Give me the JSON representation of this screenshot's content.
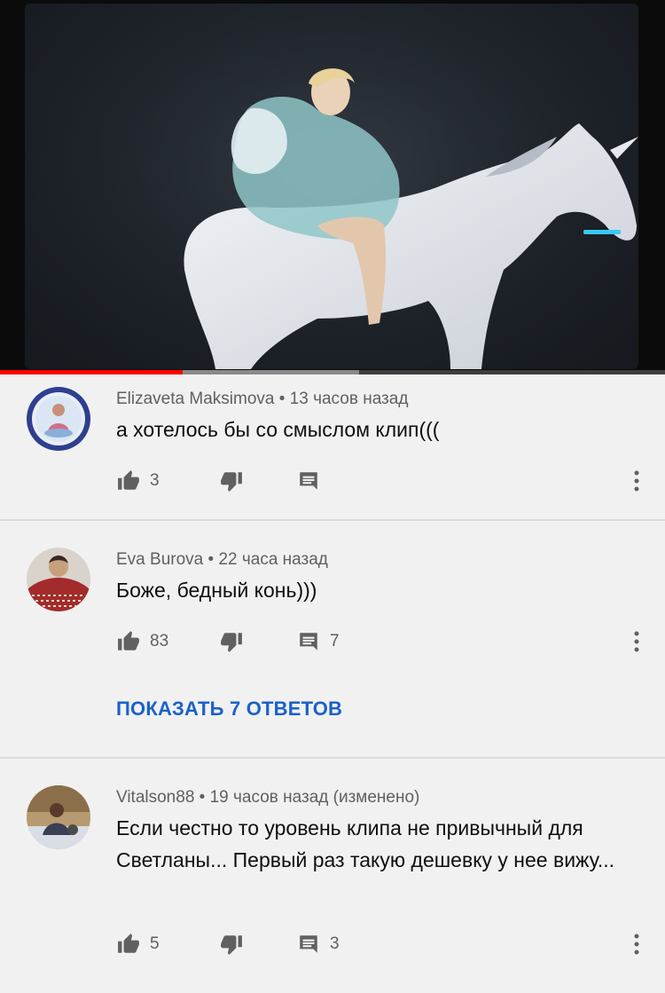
{
  "video": {
    "progress_played": 0.275,
    "progress_buffered": 0.54,
    "accent_color": "#ff0000"
  },
  "comments": [
    {
      "author": "Elizaveta Maksimova",
      "separator": "•",
      "time": "13 часов назад",
      "text": "а хотелось бы со смыслом клип(((",
      "likes": "3",
      "replies": "",
      "show_replies_label": ""
    },
    {
      "author": "Eva Burova",
      "separator": "•",
      "time": "22 часа назад",
      "text": "Боже, бедный конь)))",
      "likes": "83",
      "replies": "7",
      "show_replies_label": "ПОКАЗАТЬ 7 ОТВЕТОВ"
    },
    {
      "author": "Vitalson88",
      "separator": "•",
      "time": "19 часов назад (изменено)",
      "text": "Если честно то уровень клипа не привычный для Светланы... Первый раз такую дешевку у нее вижу...",
      "likes": "5",
      "replies": "3",
      "show_replies_label": ""
    }
  ],
  "icons": {
    "like": "thumb-up-icon",
    "dislike": "thumb-down-icon",
    "reply": "comment-icon",
    "more": "more-vert-icon"
  },
  "colors": {
    "link": "#1a61c9",
    "meta": "#606060",
    "background": "#f1f1f1"
  }
}
